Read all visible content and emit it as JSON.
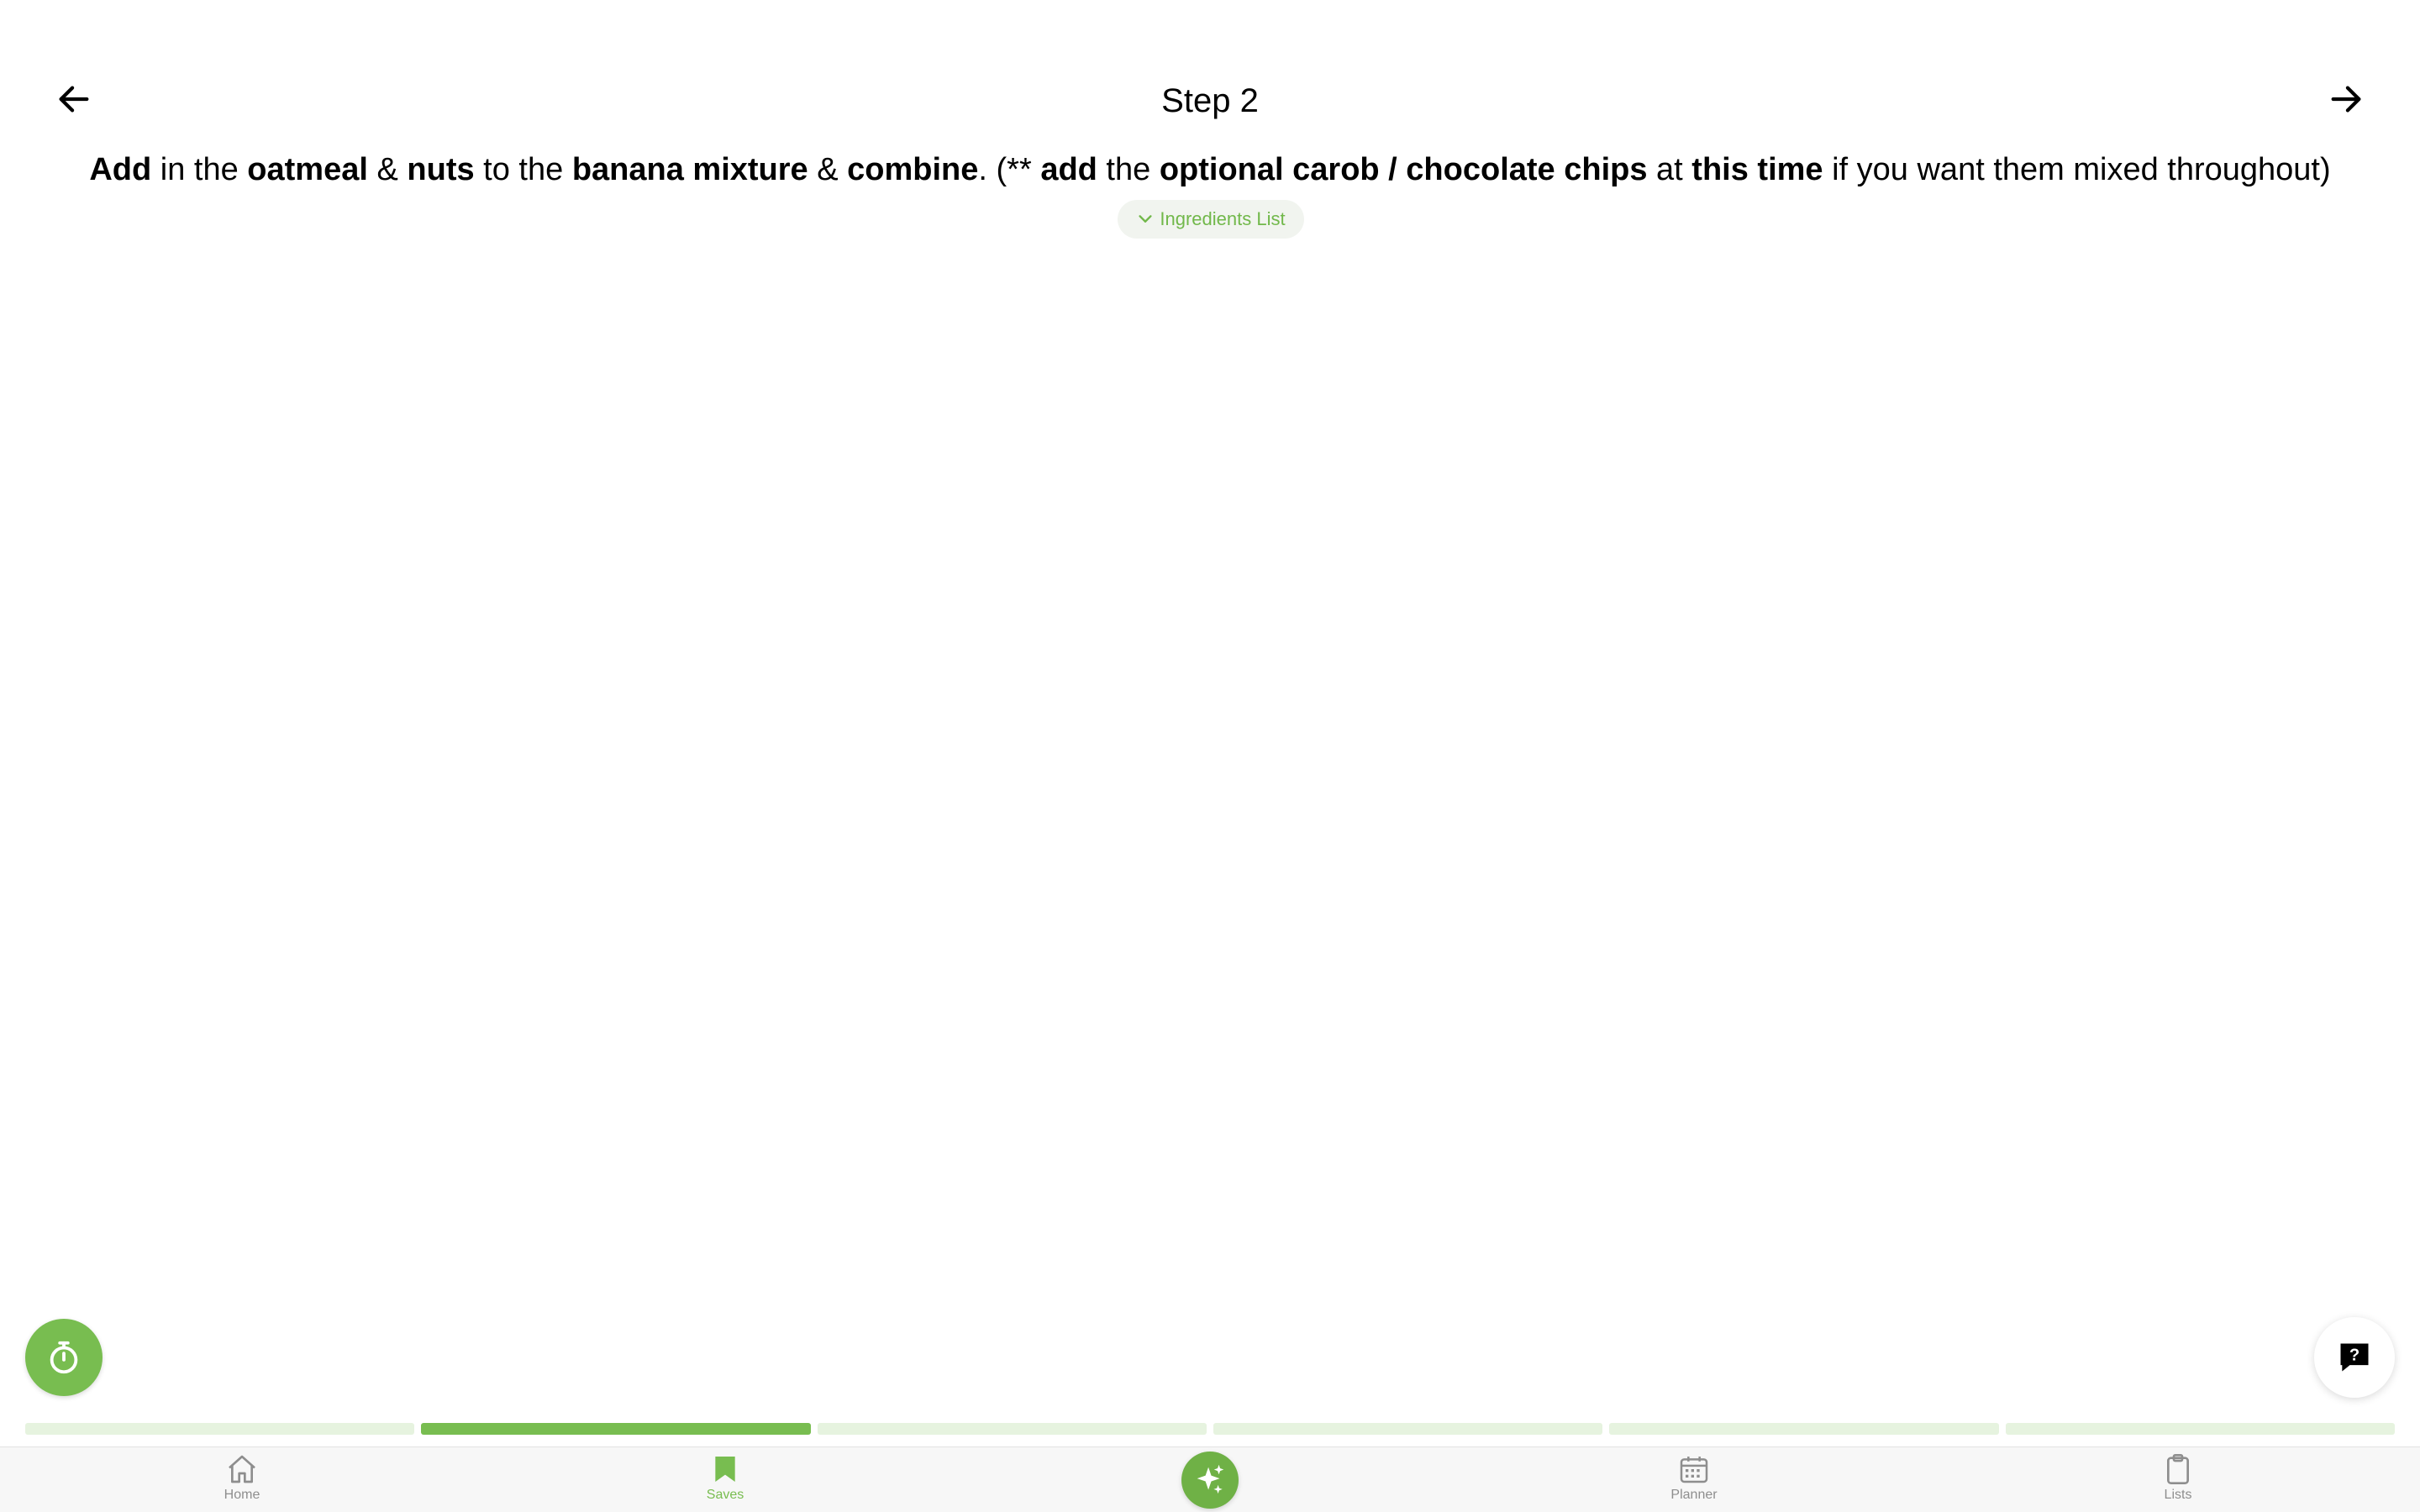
{
  "header": {
    "title": "Step 2",
    "back_icon": "arrow-left-icon",
    "next_icon": "arrow-right-icon"
  },
  "instruction": {
    "segments": [
      {
        "text": "Add",
        "bold": true
      },
      {
        "text": " in the ",
        "bold": false
      },
      {
        "text": "oatmeal",
        "bold": true
      },
      {
        "text": " & ",
        "bold": false
      },
      {
        "text": "nuts",
        "bold": true
      },
      {
        "text": " to the ",
        "bold": false
      },
      {
        "text": "banana mixture",
        "bold": true
      },
      {
        "text": " & ",
        "bold": false
      },
      {
        "text": "combine",
        "bold": true
      },
      {
        "text": ". (** ",
        "bold": false
      },
      {
        "text": "add",
        "bold": true
      },
      {
        "text": " the ",
        "bold": false
      },
      {
        "text": "optional carob / chocolate chips",
        "bold": true
      },
      {
        "text": " at ",
        "bold": false
      },
      {
        "text": "this time",
        "bold": true
      },
      {
        "text": " if you want them mixed throughout)",
        "bold": false
      }
    ]
  },
  "ingredients_toggle": {
    "label": "Ingredients List",
    "icon": "chevron-down-icon"
  },
  "fabs": {
    "timer_icon": "timer-icon",
    "help_icon": "help-chat-icon",
    "assistant_icon": "sparkles-icon"
  },
  "progress": {
    "total_steps": 6,
    "current_step": 2
  },
  "tabbar": {
    "items": [
      {
        "label": "Home",
        "icon": "home-icon",
        "active": false
      },
      {
        "label": "Saves",
        "icon": "bookmark-icon",
        "active": true
      },
      {
        "label": "Planner",
        "icon": "calendar-icon",
        "active": false
      },
      {
        "label": "Lists",
        "icon": "clipboard-icon",
        "active": false
      }
    ]
  },
  "colors": {
    "accent": "#78bd50",
    "accent_light": "#e6f3df",
    "inactive": "#8e8e8e",
    "tabbar_bg": "#f7f7f7"
  }
}
